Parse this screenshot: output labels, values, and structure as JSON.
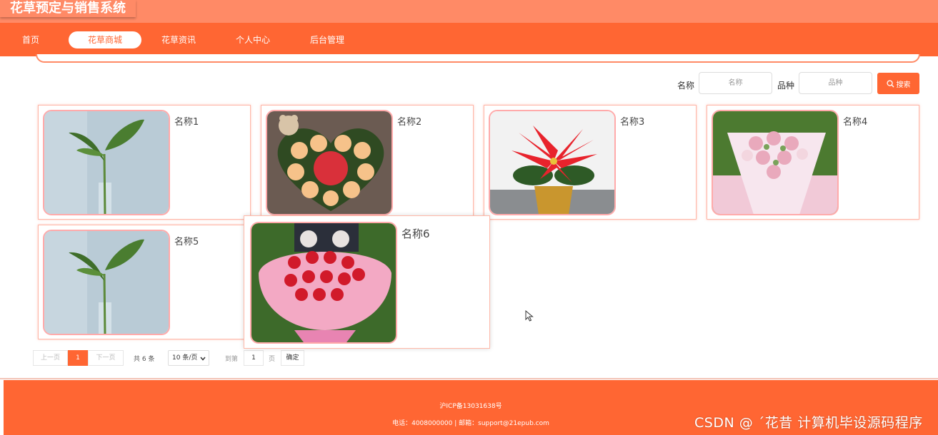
{
  "header": {
    "site_title": "花草预定与销售系统"
  },
  "nav": {
    "items": [
      {
        "label": "首页"
      },
      {
        "label": "花草商城",
        "active": true
      },
      {
        "label": "花草资讯"
      },
      {
        "label": "个人中心"
      },
      {
        "label": "后台管理"
      }
    ]
  },
  "search": {
    "name_label": "名称",
    "name_placeholder": "名称",
    "variety_label": "品种",
    "variety_placeholder": "品种",
    "button_label": "搜索",
    "button_icon": "search-icon"
  },
  "products": [
    {
      "name": "名称1",
      "image": "green-plant-in-vase"
    },
    {
      "name": "名称2",
      "image": "heart-box-roses-apple"
    },
    {
      "name": "名称3",
      "image": "red-poinsettia-pot"
    },
    {
      "name": "名称4",
      "image": "pink-rose-bouquet"
    },
    {
      "name": "名称5",
      "image": "green-plant-in-vase"
    },
    {
      "name": "名称6",
      "image": "red-rose-bouquet-with-bears"
    }
  ],
  "pagination": {
    "prev_label": "上一页",
    "current_page": "1",
    "next_label": "下一页",
    "total_text": "共 6 条",
    "page_size": "10 条/页",
    "goto_label": "到第",
    "goto_value": "1",
    "page_unit": "页",
    "confirm_label": "确定"
  },
  "footer": {
    "icp": "沪ICP备13031638号",
    "contact": "电话：4008000000 | 邮箱：support@21epub.com"
  },
  "watermark": "CSDN @ ˊ花昔  计算机毕设源码程序",
  "colors": {
    "primary": "#ff6633",
    "header": "#ff8a66",
    "card_border": "#ffb8a8"
  }
}
